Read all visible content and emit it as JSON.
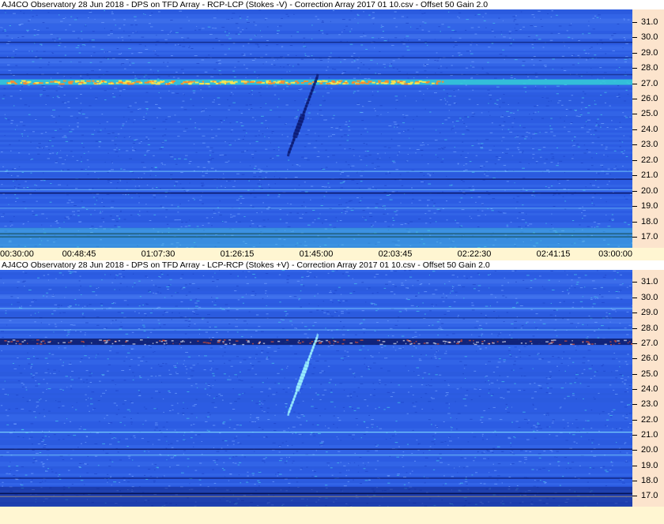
{
  "panels": [
    {
      "title": "AJ4CO Observatory 28 Jun 2018  -  DPS on TFD Array  -  RCP-LCP (Stokes -V)  -  Correction Array 2017 01 10.csv  -  Offset 50  Gain 2.0",
      "mode": "dark"
    },
    {
      "title": "AJ4CO Observatory 28 Jun 2018  -  DPS on TFD Array  -  LCP-RCP (Stokes +V)  -  Correction Array 2017 01 10.csv  -  Offset 50  Gain 2.0",
      "mode": "light"
    }
  ],
  "time_labels": [
    "00:30:00",
    "00:48:45",
    "01:07:30",
    "01:26:15",
    "01:45:00",
    "02:03:45",
    "02:22:30",
    "02:41:15",
    "03:00:00"
  ],
  "chart_data": {
    "type": "heatmap",
    "xlabel": "",
    "ylabel": "",
    "x_ticks": [
      "00:30:00",
      "00:48:45",
      "01:07:30",
      "01:26:15",
      "01:45:00",
      "02:03:45",
      "02:22:30",
      "02:41:15",
      "03:00:00"
    ],
    "y_ticks": [
      "31.0",
      "30.0",
      "29.0",
      "28.0",
      "27.0",
      "26.0",
      "25.0",
      "24.0",
      "23.0",
      "22.0",
      "21.0",
      "20.0",
      "19.0",
      "18.0",
      "17.0"
    ],
    "ylim": [
      16.3,
      31.8
    ],
    "bright_band_mhz": 27.1,
    "event_time": "01:45:00",
    "colors": {
      "background": "#2f5fe3",
      "axis_bg": "#fce4cd",
      "timebar_bg": "#fff6d2"
    }
  }
}
